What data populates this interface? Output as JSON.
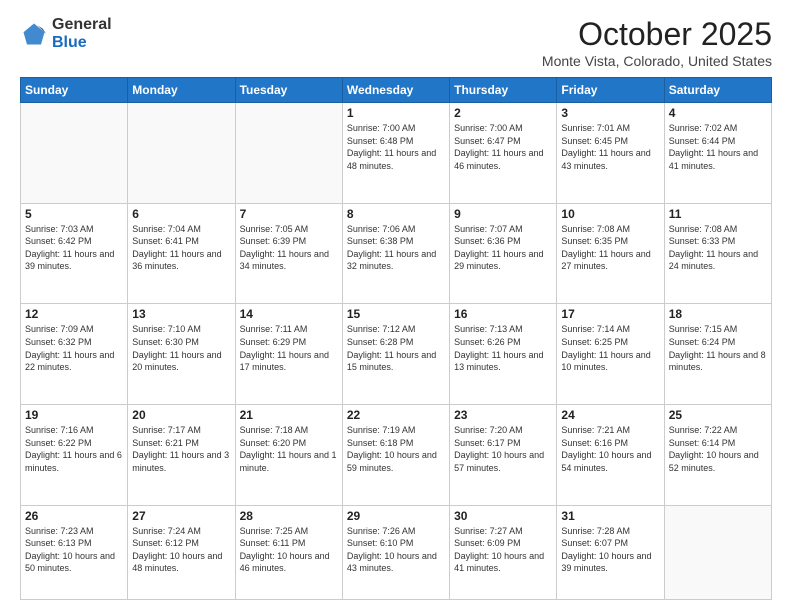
{
  "logo": {
    "general": "General",
    "blue": "Blue"
  },
  "header": {
    "month": "October 2025",
    "location": "Monte Vista, Colorado, United States"
  },
  "weekdays": [
    "Sunday",
    "Monday",
    "Tuesday",
    "Wednesday",
    "Thursday",
    "Friday",
    "Saturday"
  ],
  "weeks": [
    [
      {
        "day": "",
        "info": ""
      },
      {
        "day": "",
        "info": ""
      },
      {
        "day": "",
        "info": ""
      },
      {
        "day": "1",
        "info": "Sunrise: 7:00 AM\nSunset: 6:48 PM\nDaylight: 11 hours and 48 minutes."
      },
      {
        "day": "2",
        "info": "Sunrise: 7:00 AM\nSunset: 6:47 PM\nDaylight: 11 hours and 46 minutes."
      },
      {
        "day": "3",
        "info": "Sunrise: 7:01 AM\nSunset: 6:45 PM\nDaylight: 11 hours and 43 minutes."
      },
      {
        "day": "4",
        "info": "Sunrise: 7:02 AM\nSunset: 6:44 PM\nDaylight: 11 hours and 41 minutes."
      }
    ],
    [
      {
        "day": "5",
        "info": "Sunrise: 7:03 AM\nSunset: 6:42 PM\nDaylight: 11 hours and 39 minutes."
      },
      {
        "day": "6",
        "info": "Sunrise: 7:04 AM\nSunset: 6:41 PM\nDaylight: 11 hours and 36 minutes."
      },
      {
        "day": "7",
        "info": "Sunrise: 7:05 AM\nSunset: 6:39 PM\nDaylight: 11 hours and 34 minutes."
      },
      {
        "day": "8",
        "info": "Sunrise: 7:06 AM\nSunset: 6:38 PM\nDaylight: 11 hours and 32 minutes."
      },
      {
        "day": "9",
        "info": "Sunrise: 7:07 AM\nSunset: 6:36 PM\nDaylight: 11 hours and 29 minutes."
      },
      {
        "day": "10",
        "info": "Sunrise: 7:08 AM\nSunset: 6:35 PM\nDaylight: 11 hours and 27 minutes."
      },
      {
        "day": "11",
        "info": "Sunrise: 7:08 AM\nSunset: 6:33 PM\nDaylight: 11 hours and 24 minutes."
      }
    ],
    [
      {
        "day": "12",
        "info": "Sunrise: 7:09 AM\nSunset: 6:32 PM\nDaylight: 11 hours and 22 minutes."
      },
      {
        "day": "13",
        "info": "Sunrise: 7:10 AM\nSunset: 6:30 PM\nDaylight: 11 hours and 20 minutes."
      },
      {
        "day": "14",
        "info": "Sunrise: 7:11 AM\nSunset: 6:29 PM\nDaylight: 11 hours and 17 minutes."
      },
      {
        "day": "15",
        "info": "Sunrise: 7:12 AM\nSunset: 6:28 PM\nDaylight: 11 hours and 15 minutes."
      },
      {
        "day": "16",
        "info": "Sunrise: 7:13 AM\nSunset: 6:26 PM\nDaylight: 11 hours and 13 minutes."
      },
      {
        "day": "17",
        "info": "Sunrise: 7:14 AM\nSunset: 6:25 PM\nDaylight: 11 hours and 10 minutes."
      },
      {
        "day": "18",
        "info": "Sunrise: 7:15 AM\nSunset: 6:24 PM\nDaylight: 11 hours and 8 minutes."
      }
    ],
    [
      {
        "day": "19",
        "info": "Sunrise: 7:16 AM\nSunset: 6:22 PM\nDaylight: 11 hours and 6 minutes."
      },
      {
        "day": "20",
        "info": "Sunrise: 7:17 AM\nSunset: 6:21 PM\nDaylight: 11 hours and 3 minutes."
      },
      {
        "day": "21",
        "info": "Sunrise: 7:18 AM\nSunset: 6:20 PM\nDaylight: 11 hours and 1 minute."
      },
      {
        "day": "22",
        "info": "Sunrise: 7:19 AM\nSunset: 6:18 PM\nDaylight: 10 hours and 59 minutes."
      },
      {
        "day": "23",
        "info": "Sunrise: 7:20 AM\nSunset: 6:17 PM\nDaylight: 10 hours and 57 minutes."
      },
      {
        "day": "24",
        "info": "Sunrise: 7:21 AM\nSunset: 6:16 PM\nDaylight: 10 hours and 54 minutes."
      },
      {
        "day": "25",
        "info": "Sunrise: 7:22 AM\nSunset: 6:14 PM\nDaylight: 10 hours and 52 minutes."
      }
    ],
    [
      {
        "day": "26",
        "info": "Sunrise: 7:23 AM\nSunset: 6:13 PM\nDaylight: 10 hours and 50 minutes."
      },
      {
        "day": "27",
        "info": "Sunrise: 7:24 AM\nSunset: 6:12 PM\nDaylight: 10 hours and 48 minutes."
      },
      {
        "day": "28",
        "info": "Sunrise: 7:25 AM\nSunset: 6:11 PM\nDaylight: 10 hours and 46 minutes."
      },
      {
        "day": "29",
        "info": "Sunrise: 7:26 AM\nSunset: 6:10 PM\nDaylight: 10 hours and 43 minutes."
      },
      {
        "day": "30",
        "info": "Sunrise: 7:27 AM\nSunset: 6:09 PM\nDaylight: 10 hours and 41 minutes."
      },
      {
        "day": "31",
        "info": "Sunrise: 7:28 AM\nSunset: 6:07 PM\nDaylight: 10 hours and 39 minutes."
      },
      {
        "day": "",
        "info": ""
      }
    ]
  ]
}
